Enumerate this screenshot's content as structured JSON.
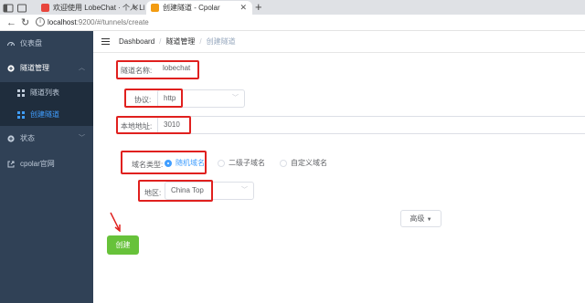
{
  "browser": {
    "tabs": [
      {
        "title": "欢迎使用 LobeChat · 个人 LLM 生",
        "fav_color": "#e8453c"
      },
      {
        "title": "创建隧道 - Cpolar",
        "fav_color": "#f39c12"
      }
    ],
    "url_host": "localhost",
    "url_path": ":9200/#/tunnels/create"
  },
  "sidebar": {
    "dashboard": "仪表盘",
    "tunnel_mgmt": "隧道管理",
    "tunnel_list": "隧道列表",
    "create_tunnel": "创建隧道",
    "status": "状态",
    "website": "cpolar官网"
  },
  "breadcrumb": {
    "home": "Dashboard",
    "section": "隧道管理",
    "current": "创建隧道"
  },
  "form": {
    "tunnel_name_label": "隧道名称:",
    "tunnel_name_value": "lobechat",
    "protocol_label": "协议:",
    "protocol_value": "http",
    "local_addr_label": "本地地址:",
    "local_addr_value": "3010",
    "domain_type_label": "域名类型:",
    "domain_options": [
      "随机域名",
      "二级子域名",
      "自定义域名"
    ],
    "region_label": "地区:",
    "region_value": "China Top",
    "advanced_label": "高级",
    "create_label": "创建"
  },
  "colors": {
    "sidebar_bg": "#304156",
    "accent": "#409eff",
    "create_button": "#67c23a",
    "highlight_box": "#e0201e"
  }
}
